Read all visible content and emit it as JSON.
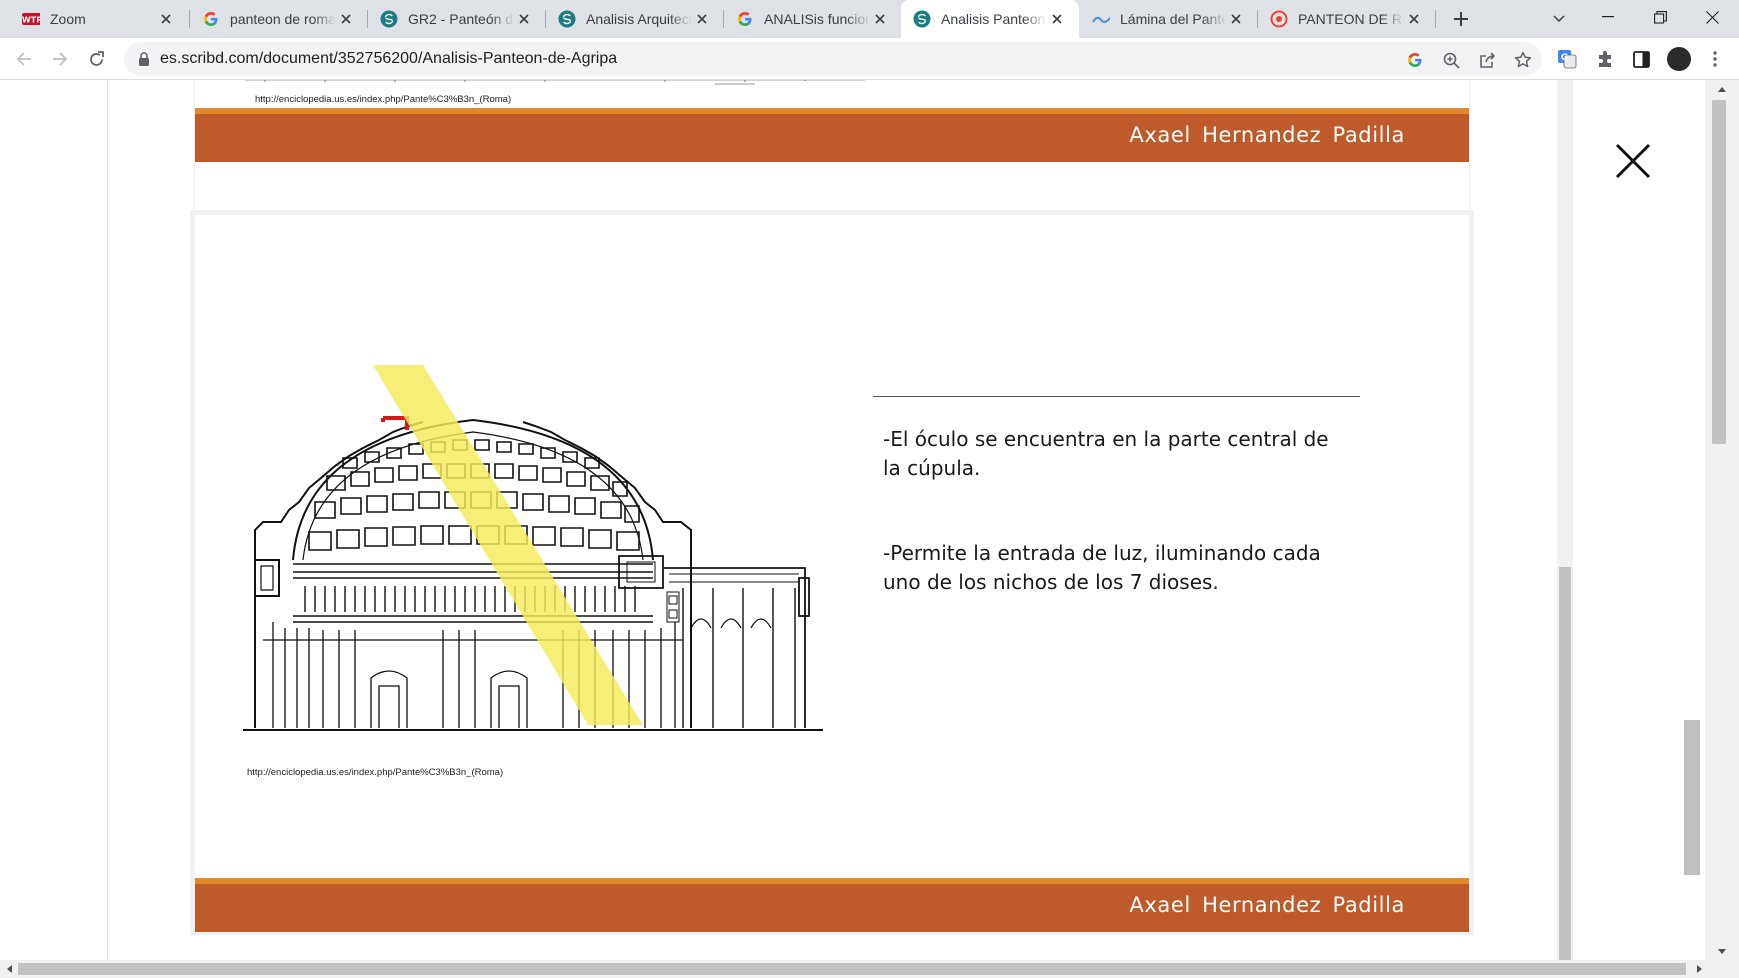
{
  "browser": {
    "tabs": [
      {
        "title": "Zoom",
        "favicon": "zoom-favicon-icon",
        "active": false
      },
      {
        "title": "panteon de roma",
        "favicon": "google-g-icon",
        "active": false
      },
      {
        "title": "GR2 - Panteón de",
        "favicon": "scribd-icon",
        "active": false
      },
      {
        "title": "Analisis Arquitect",
        "favicon": "scribd-icon",
        "active": false
      },
      {
        "title": "ANALISis funcion",
        "favicon": "google-g-icon",
        "active": false
      },
      {
        "title": "Analisis Panteon d",
        "favicon": "scribd-icon",
        "active": true
      },
      {
        "title": "Lámina del Pante",
        "favicon": "sway-icon",
        "active": false
      },
      {
        "title": "PANTEON DE RO",
        "favicon": "pdf-red-icon",
        "active": false
      }
    ],
    "url": "es.scribd.com/document/352756200/Analisis-Panteon-de-Agripa"
  },
  "document": {
    "prev_slide_source": "http://enciclopedia.us.es/index.php/Pante%C3%B3n_(Roma)",
    "prev_slide_author": "Axael Hernandez Padilla",
    "slide": {
      "bullet1": "-El óculo se encuentra en la parte central de la cúpula.",
      "bullet2": "-Permite la entrada de luz, iluminando cada uno de los nichos de los 7 dioses.",
      "image_source": "http://enciclopedia.us.es/index.php/Pante%C3%B3n_(Roma)",
      "author": "Axael Hernandez Padilla"
    }
  },
  "colors": {
    "orange_bar": "#bf5a2b",
    "orange_stripe": "#e08a2d",
    "light_beam": "#f3ec5a"
  }
}
